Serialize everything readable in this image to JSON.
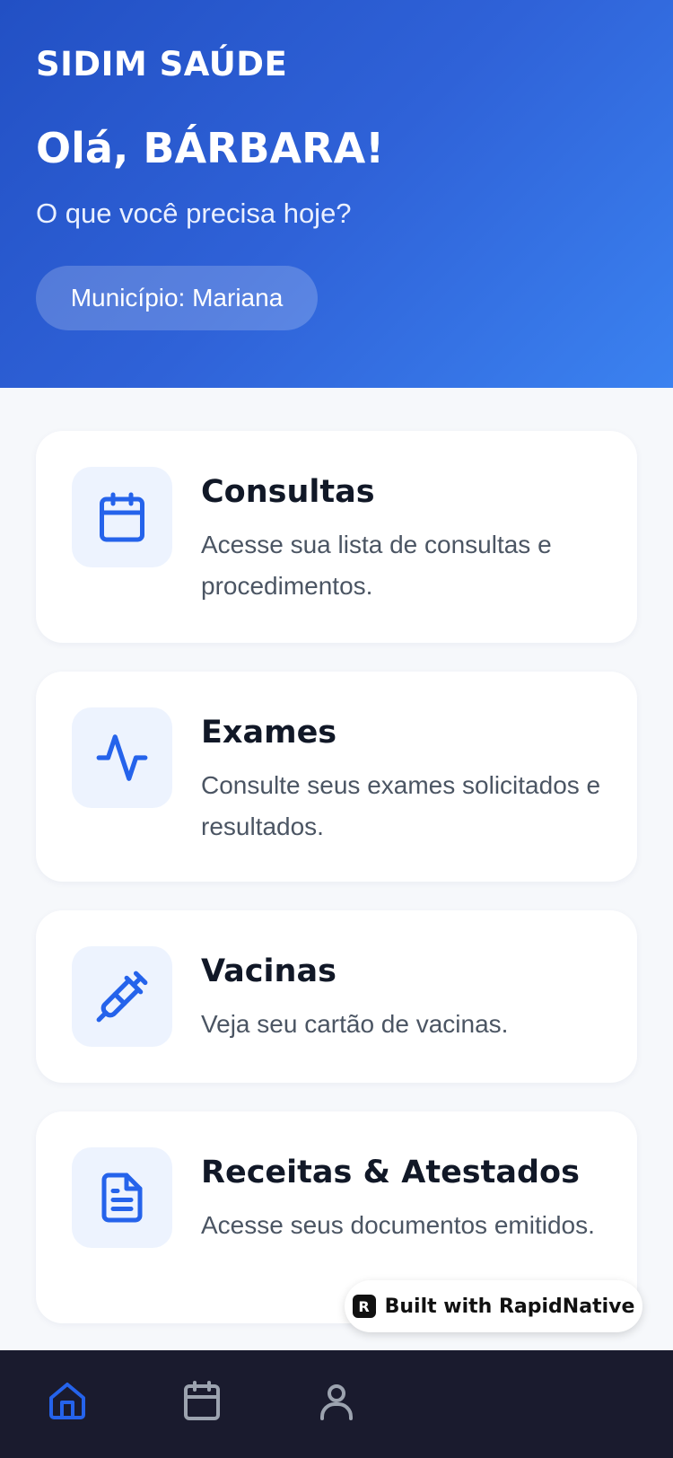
{
  "header": {
    "brand": "SIDIM SAÚDE",
    "greeting": "Olá, BÁRBARA!",
    "subtitle": "O que você precisa hoje?",
    "municipality_label": "Município: Mariana"
  },
  "cards": [
    {
      "title": "Consultas",
      "description": "Acesse sua lista de consultas e procedimentos.",
      "icon": "calendar-icon"
    },
    {
      "title": "Exames",
      "description": "Consulte seus exames solicitados e resultados.",
      "icon": "activity-icon"
    },
    {
      "title": "Vacinas",
      "description": "Veja seu cartão de vacinas.",
      "icon": "syringe-icon"
    },
    {
      "title": "Receitas & Atestados",
      "description": "Acesse seus documentos emitidos.",
      "icon": "document-icon"
    }
  ],
  "badge": {
    "logo": "R",
    "text": "Built with RapidNative"
  },
  "tabbar": {
    "tabs": [
      {
        "icon": "home-icon",
        "active": true
      },
      {
        "icon": "calendar-icon",
        "active": false
      },
      {
        "icon": "user-icon",
        "active": false
      },
      {
        "icon": "more-icon",
        "active": false
      },
      {
        "icon": "more-icon",
        "active": false
      }
    ]
  },
  "colors": {
    "accent": "#2563eb",
    "header_gradient_start": "#2250c4",
    "header_gradient_end": "#3b82f0",
    "tabbar_background": "#1a1b2e",
    "tab_inactive": "#9ca3af",
    "icon_tile": "#edf3fe"
  }
}
